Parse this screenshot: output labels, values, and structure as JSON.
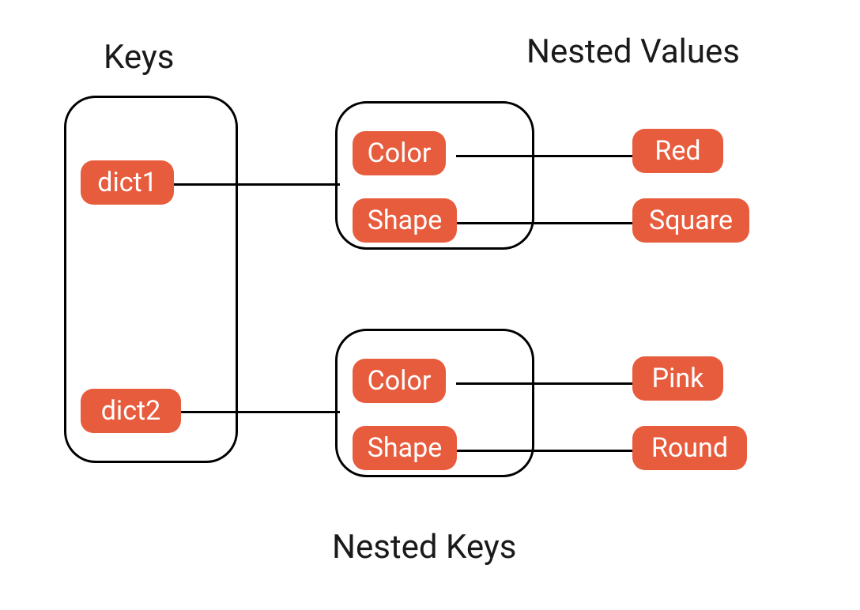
{
  "headings": {
    "keys": "Keys",
    "nestedValues": "Nested Values",
    "nestedKeys": "Nested Keys"
  },
  "outerKeys": {
    "dict1": "dict1",
    "dict2": "dict2"
  },
  "innerKeys": {
    "color1": "Color",
    "shape1": "Shape",
    "color2": "Color",
    "shape2": "Shape"
  },
  "values": {
    "red": "Red",
    "square": "Square",
    "pink": "Pink",
    "round": "Round"
  },
  "colors": {
    "pill": "#E85C3E"
  }
}
